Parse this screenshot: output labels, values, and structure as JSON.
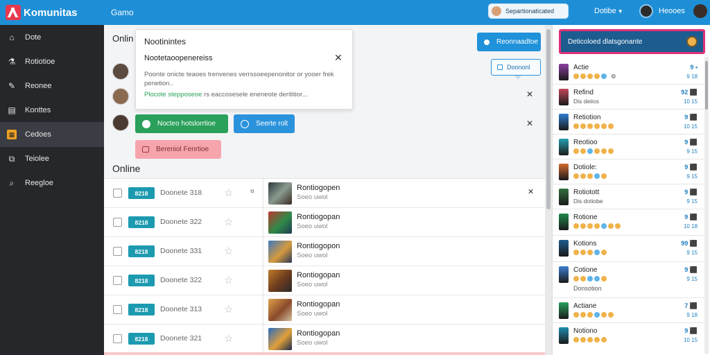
{
  "app": {
    "title": "Komunitas",
    "section": "Gamo"
  },
  "topbar": {
    "search_label": "Separtionaticated",
    "dropdown_label": "Dotibe",
    "user_label": "Heooes"
  },
  "sidebar": {
    "items": [
      {
        "label": "Dote",
        "icon": "home-icon"
      },
      {
        "label": "Rotiotioe",
        "icon": "flask-icon"
      },
      {
        "label": "Reonee",
        "icon": "tag-icon"
      },
      {
        "label": "Konttes",
        "icon": "calendar-icon"
      },
      {
        "label": "Cedoes",
        "icon": "grid-icon",
        "active": true
      },
      {
        "label": "Teiolee",
        "icon": "external-link-icon"
      },
      {
        "label": "Reegloe",
        "icon": "search-icon"
      }
    ]
  },
  "main": {
    "heading_top": "Onlin",
    "heading_online": "Online",
    "notification": {
      "title": "Nootinintes",
      "subtitle": "Nootetaoopenereiss",
      "body": "Poonte onicte teaoes trenvenes verrssoeepenonitor or yooer frek penetion..",
      "link_green": "Plocote stepposeoe",
      "link_rest": "rs eaccosesele eneneote derititior..."
    },
    "buttons": {
      "primary_top": "Reonnaadtoe",
      "outline": "Doononl",
      "green": "Nocteo hotslorrtioe",
      "blue": "Seerte rolt",
      "pink": "Bereniol Fenrtioe"
    },
    "table_rows": [
      {
        "tag": "8218",
        "name": "Doonete 318",
        "mini": "¤",
        "title": "Rontiogopen",
        "sub": "Soeo uwol",
        "x": "✕"
      },
      {
        "tag": "8218",
        "name": "Doonete 322",
        "mini": "",
        "title": "Rontiogopan",
        "sub": "Soeo uwol",
        "x": ""
      },
      {
        "tag": "8218",
        "name": "Doonete 331",
        "mini": "",
        "title": "Rontiogopon",
        "sub": "Soeo uwol",
        "x": ""
      },
      {
        "tag": "8218",
        "name": "Doonete 322",
        "mini": "",
        "title": "Rontiogopan",
        "sub": "Soeo uwol",
        "x": ""
      },
      {
        "tag": "8218",
        "name": "Doonete 313",
        "mini": "",
        "title": "Rontiogopan",
        "sub": "Soeo uwol",
        "x": ""
      },
      {
        "tag": "8218",
        "name": "Doonete 321",
        "mini": "",
        "title": "Rontiogopan",
        "sub": "Soeo uwol",
        "x": ""
      }
    ]
  },
  "right_panel": {
    "header": "Deticoloed dlatsgonante",
    "items": [
      {
        "name": "Actie",
        "value": "9 •",
        "action": "9 18",
        "thumb_color": "#8b3fa1"
      },
      {
        "name": "Refind",
        "value": "92 ⬛",
        "action": "10 15",
        "thumb_color": "#c0485a",
        "sub_text": "Dis deiios"
      },
      {
        "name": "Retiotion",
        "value": "9 ⬛",
        "action": "10 15",
        "thumb_color": "#2f7ed0"
      },
      {
        "name": "Reotioo",
        "value": "9 ⬛",
        "action": "9 15",
        "thumb_color": "#27a0b0"
      },
      {
        "name": "Dotiole:",
        "value": "9 ⬛",
        "action": "9 15",
        "thumb_color": "#d46b2f"
      },
      {
        "name": "Rotiotott",
        "value": "9 ⬛",
        "action": "9 15",
        "thumb_color": "#33703d",
        "sub_text": "Dis dotiobe"
      },
      {
        "name": "Rotione",
        "value": "9 ⬛",
        "action": "10 18",
        "thumb_color": "#1f8c4a"
      },
      {
        "name": "Kotions",
        "value": "99 ⬛",
        "action": "9 15",
        "thumb_color": "#1d5c8e"
      },
      {
        "name": "Cotione",
        "value": "9 ⬛",
        "action": "9 15",
        "thumb_color": "#3d7fd3",
        "sub_text": "Donsotion"
      },
      {
        "name": "Actiane",
        "value": "7 ⬛",
        "action": "9 18",
        "thumb_color": "#27a05a"
      },
      {
        "name": "Notiono",
        "value": "9 ⬛",
        "action": "10 15",
        "thumb_color": "#1f8cb0"
      }
    ]
  },
  "colors": {
    "topbar": "#1e8fd6",
    "sidebar": "#25272b",
    "accent_orange": "#f0a224",
    "tag_teal": "#1c9ab0",
    "green_button": "#2aa05a",
    "pink_button": "#f6a5ad",
    "right_header": "#1d5c8e",
    "right_header_border": "#e0307a"
  }
}
